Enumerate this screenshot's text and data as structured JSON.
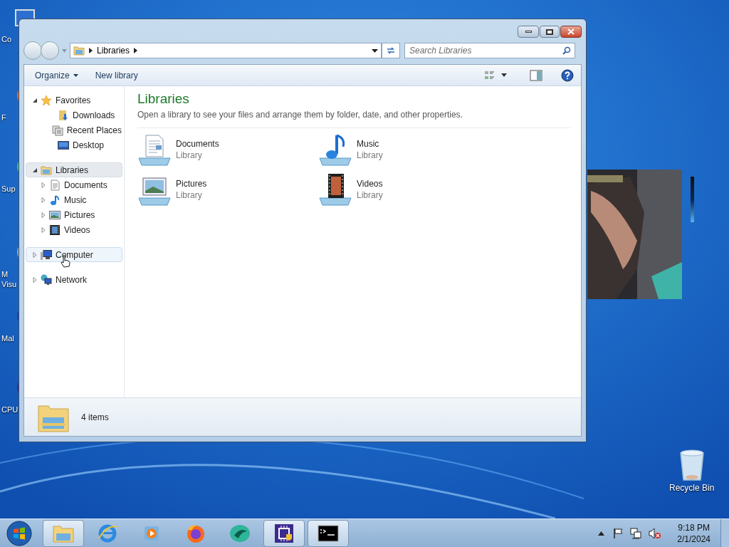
{
  "desktop": {
    "icons": [
      {
        "label": "Co",
        "kind": "computer"
      },
      {
        "label": "F",
        "kind": "shortcut-orange"
      },
      {
        "label": "Sup",
        "kind": "shortcut-green"
      },
      {
        "label": "M\nVisu",
        "kind": "shortcut-grey"
      },
      {
        "label": "Mal",
        "kind": "shortcut-blue"
      },
      {
        "label": "CPU",
        "kind": "shortcut-purple"
      },
      {
        "label": "Recycle Bin",
        "kind": "recycle-bin"
      }
    ]
  },
  "window": {
    "address": {
      "crumbs": [
        "Libraries"
      ]
    },
    "search": {
      "placeholder": "Search Libraries"
    },
    "toolbar": {
      "buttons": [
        {
          "label": "Organize",
          "dropdown": true
        },
        {
          "label": "New library",
          "dropdown": false
        }
      ]
    },
    "sidebar": {
      "items": [
        {
          "label": "Favorites",
          "kind": "star",
          "expanded": true,
          "selected": false,
          "hovered": false,
          "children": [
            {
              "label": "Downloads",
              "kind": "downloads"
            },
            {
              "label": "Recent Places",
              "kind": "recent"
            },
            {
              "label": "Desktop",
              "kind": "desktop"
            }
          ]
        },
        {
          "label": "Libraries",
          "kind": "library",
          "expanded": true,
          "selected": true,
          "hovered": false,
          "children": [
            {
              "label": "Documents",
              "kind": "documents",
              "expanded": false
            },
            {
              "label": "Music",
              "kind": "music",
              "expanded": false
            },
            {
              "label": "Pictures",
              "kind": "pictures",
              "expanded": false
            },
            {
              "label": "Videos",
              "kind": "videos",
              "expanded": false
            }
          ]
        },
        {
          "label": "Computer",
          "kind": "computer",
          "expanded": false,
          "selected": false,
          "hovered": true
        },
        {
          "label": "Network",
          "kind": "network",
          "expanded": false,
          "selected": false,
          "hovered": false
        }
      ]
    },
    "content": {
      "title": "Libraries",
      "description": "Open a library to see your files and arrange them by folder, date, and other properties.",
      "libraries": [
        {
          "name": "Documents",
          "type": "Library",
          "kind": "documents"
        },
        {
          "name": "Music",
          "type": "Library",
          "kind": "music"
        },
        {
          "name": "Pictures",
          "type": "Library",
          "kind": "pictures"
        },
        {
          "name": "Videos",
          "type": "Library",
          "kind": "videos"
        }
      ]
    },
    "status_bar": {
      "count": "4 items"
    }
  },
  "taskbar": {
    "apps": [
      {
        "kind": "explorer",
        "running": true
      },
      {
        "kind": "browser-e",
        "running": false
      },
      {
        "kind": "media",
        "running": false
      },
      {
        "kind": "firefox",
        "running": false
      },
      {
        "kind": "green",
        "running": false
      },
      {
        "kind": "chip",
        "running": true
      },
      {
        "kind": "terminal",
        "running": true
      }
    ],
    "clock": {
      "time": "9:18 PM",
      "date": "2/1/2024"
    }
  }
}
